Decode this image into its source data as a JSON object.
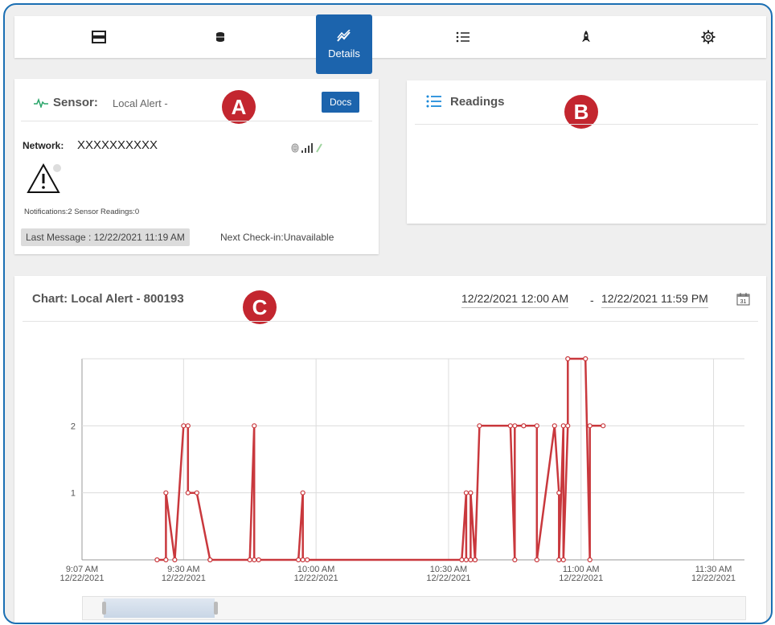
{
  "nav": {
    "items": [
      "overview-icon",
      "database-icon",
      "details-icon",
      "list-icon",
      "rocket-icon",
      "gear-icon"
    ],
    "active_label": "Details"
  },
  "sensor_card": {
    "title": "Sensor:",
    "name": "Local Alert -",
    "docs_label": "Docs",
    "network_label": "Network:",
    "network_value": "XXXXXXXXXX",
    "notifications_text": "Notifications:2 Sensor Readings:0",
    "last_message": "Last Message : 12/22/2021 11:19 AM",
    "next_checkin": "Next Check-in:Unavailable",
    "badge": "A"
  },
  "readings_card": {
    "title": "Readings",
    "badge": "B"
  },
  "chart_card": {
    "title": "Chart: Local Alert - 800193",
    "badge": "C",
    "date_from": "12/22/2021 12:00 AM",
    "separator": "-",
    "date_to": "12/22/2021 11:59 PM",
    "calendar_day": "31"
  },
  "chart_data": {
    "type": "line",
    "title": "Chart: Local Alert - 800193",
    "xlabel": "",
    "ylabel": "",
    "x_ticks": [
      "9:07 AM",
      "9:30 AM",
      "10:00 AM",
      "10:30 AM",
      "11:00 AM",
      "11:30 AM"
    ],
    "x_tick_date": "12/22/2021",
    "y_ticks": [
      1,
      2
    ],
    "ylim": [
      0,
      3
    ],
    "color": "#c9383d",
    "series": [
      {
        "x_minutes_after_9am": [
          24,
          26,
          26,
          28,
          30,
          31,
          31,
          33,
          36,
          36,
          45,
          46,
          46,
          47,
          56,
          57,
          57,
          58,
          93,
          94,
          94,
          95,
          95,
          96,
          96,
          97,
          104,
          105,
          105,
          107,
          107,
          110,
          110,
          114,
          115,
          115,
          116,
          116,
          117,
          117,
          121,
          122,
          122,
          125
        ],
        "values": [
          0,
          0,
          1,
          0,
          2,
          2,
          1,
          1,
          0,
          0,
          0,
          2,
          0,
          0,
          0,
          1,
          0,
          0,
          0,
          1,
          0,
          0,
          1,
          0,
          0,
          2,
          2,
          0,
          2,
          2,
          2,
          2,
          0,
          2,
          1,
          0,
          2,
          0,
          2,
          3,
          3,
          0,
          2,
          2
        ]
      }
    ]
  }
}
